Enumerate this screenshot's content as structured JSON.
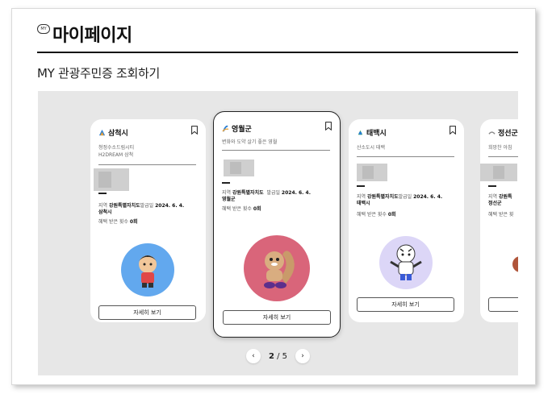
{
  "header": {
    "badge": "MY",
    "title": "마이페이지",
    "section_title": "MY 관광주민증 조회하기"
  },
  "cards": [
    {
      "name": "삼척시",
      "slogan_line1": "청정수소드림시티",
      "slogan_line2": "H2DREAM 삼척",
      "region_label": "지역",
      "region_value": "강원특별자치도",
      "issued_label": "발급일",
      "issued_value": "2024. 6. 4.",
      "city": "삼척시",
      "benefit_label": "혜택 받은 횟수",
      "benefit_value": "0회",
      "button": "자세히 보기",
      "mascot_color": "#62a8ee"
    },
    {
      "name": "영월군",
      "slogan_line1": "변화와 도약 살기 좋은 영월",
      "slogan_line2": "",
      "region_label": "지역",
      "region_value": "강원특별자치도",
      "issued_label": "발급일",
      "issued_value": "2024. 6. 4.",
      "city": "영월군",
      "benefit_label": "혜택 받은 횟수",
      "benefit_value": "0회",
      "button": "자세히 보기",
      "mascot_color": "#d9657a"
    },
    {
      "name": "태백시",
      "slogan_line1": "산소도시 태백",
      "slogan_line2": "",
      "region_label": "지역",
      "region_value": "강원특별자치도",
      "issued_label": "발급일",
      "issued_value": "2024. 6. 4.",
      "city": "태백시",
      "benefit_label": "혜택 받은 횟수",
      "benefit_value": "0회",
      "button": "자세히 보기",
      "mascot_color": "#dcd6f7"
    },
    {
      "name": "정선군",
      "slogan_line1": "희망찬 아침",
      "slogan_line2": "",
      "region_label": "지역",
      "region_value": "강원특",
      "issued_label": "",
      "issued_value": "",
      "city": "정선군",
      "benefit_label": "혜택 받은 횟",
      "benefit_value": "",
      "button": "",
      "mascot_color": "#c9a68a"
    }
  ],
  "pager": {
    "prev": "‹",
    "current": "2",
    "separator": " / ",
    "total": "5",
    "next": "›"
  }
}
